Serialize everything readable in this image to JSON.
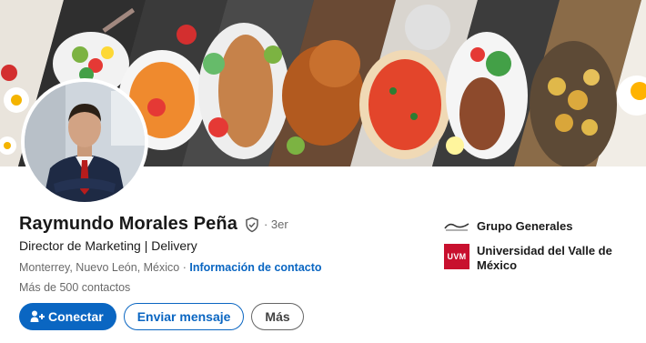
{
  "profile": {
    "name": "Raymundo Morales Peña",
    "degree": "· 3er",
    "headline": "Director de Marketing | Delivery",
    "location": "Monterrey, Nuevo León, México",
    "separator": "·",
    "contact_link": "Información de contacto",
    "connections": "Más de 500 contactos"
  },
  "actions": {
    "connect_label": "Conectar",
    "message_label": "Enviar mensaje",
    "more_label": "Más"
  },
  "sidebar": {
    "items": [
      {
        "label": "Grupo Generales",
        "icon": "company-logo"
      },
      {
        "label": "Universidad del Valle de México",
        "icon": "uvm-logo",
        "logo_text": "UVM"
      }
    ]
  },
  "colors": {
    "accent": "#0a66c2",
    "uvm": "#c8102e"
  }
}
